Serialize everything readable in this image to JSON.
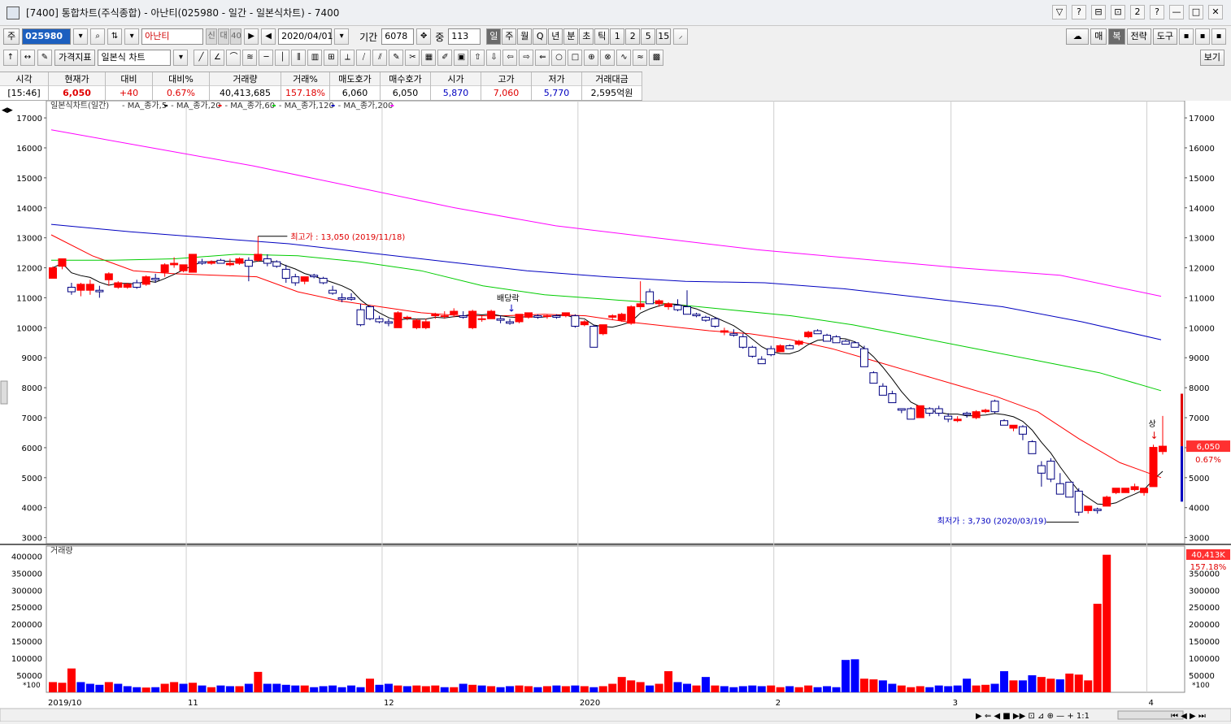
{
  "window": {
    "title": "[7400] 통합차트(주식종합) - 아난티(025980 - 일간 - 일본식차트) - 7400",
    "buttons": [
      "▽",
      "?",
      "⊟",
      "⊡",
      "2",
      "?",
      "—",
      "□",
      "✕"
    ]
  },
  "toolbar1": {
    "market": "주",
    "code": "025980",
    "name": "아난티",
    "name_tags": [
      "신",
      "대",
      "40"
    ],
    "date": "2020/04/01",
    "period_label": "기간",
    "period_value": "6078",
    "count_label": "중",
    "count_value": "113",
    "intervals": [
      "일",
      "주",
      "월",
      "Q",
      "년",
      "분",
      "초",
      "틱",
      "1",
      "2",
      "5",
      "15"
    ],
    "active_interval": "일",
    "right_buttons": [
      "매",
      "복",
      "전략",
      "도구"
    ]
  },
  "toolbar2": {
    "indicator_btn": "가격지표",
    "chart_type": "일본식 차트",
    "view_btn": "보기"
  },
  "quote": {
    "headers": [
      "시각",
      "현재가",
      "대비",
      "대비%",
      "거래량",
      "거래%",
      "매도호가",
      "매수호가",
      "시가",
      "고가",
      "저가",
      "거래대금"
    ],
    "values": [
      "[15:46]",
      "6,050",
      "+40",
      "0.67%",
      "40,413,685",
      "157.18%",
      "6,060",
      "6,050",
      "5,870",
      "7,060",
      "5,770",
      "2,595억원"
    ],
    "value_colors": [
      "#000000",
      "#e00000",
      "#e00000",
      "#e00000",
      "#000000",
      "#e00000",
      "#000000",
      "#000000",
      "#0000c0",
      "#e00000",
      "#0000c0",
      "#000000"
    ]
  },
  "chart": {
    "legend_title": "일본식차트(일간)",
    "legend_items": [
      {
        "name": "MA_종가,5",
        "color": "#000000"
      },
      {
        "name": "MA_종가,20",
        "color": "#ff0000"
      },
      {
        "name": "MA_종가,60",
        "color": "#00cc00"
      },
      {
        "name": "MA_종가,120",
        "color": "#0000c0"
      },
      {
        "name": "MA_종가,200",
        "color": "#ff00ff"
      }
    ],
    "annotations": {
      "high": "최고가 : 13,050 (2019/11/18)",
      "low": "최저가 : 3,730 (2020/03/19)",
      "dividend": "배당락",
      "upper_limit": "상"
    },
    "price_tag": "6,050",
    "price_pct": "0.67%",
    "volume_title": "거래량",
    "volume_tag": "40,413K",
    "volume_pct": "157.18%",
    "volume_unit": "*100",
    "x_labels": [
      "2019/10",
      "11",
      "12",
      "2020",
      "2",
      "3",
      "4"
    ],
    "price_axis": [
      17000,
      16000,
      15000,
      14000,
      13000,
      12000,
      11000,
      10000,
      9000,
      8000,
      7000,
      6000,
      5000,
      4000,
      3000
    ],
    "volume_axis": [
      400000,
      350000,
      300000,
      250000,
      200000,
      150000,
      100000,
      50000
    ]
  },
  "chart_data": {
    "type": "candlestick",
    "ylim": [
      2800,
      17300
    ],
    "candles": [
      [
        11650,
        12050,
        11650,
        12000
      ],
      [
        12050,
        12300,
        11950,
        12300
      ],
      [
        11350,
        11500,
        11100,
        11200
      ],
      [
        11250,
        11500,
        11050,
        11450
      ],
      [
        11250,
        11600,
        11100,
        11450
      ],
      [
        11250,
        11400,
        11000,
        11200
      ],
      [
        11600,
        11850,
        11400,
        11800
      ],
      [
        11350,
        11550,
        11300,
        11500
      ],
      [
        11350,
        11500,
        11300,
        11450
      ],
      [
        11500,
        11600,
        11300,
        11350
      ],
      [
        11450,
        11750,
        11400,
        11700
      ],
      [
        11650,
        11800,
        11500,
        11600
      ],
      [
        11850,
        12150,
        11700,
        12100
      ],
      [
        12100,
        12350,
        12000,
        12150
      ],
      [
        11900,
        12100,
        11850,
        12100
      ],
      [
        11850,
        12450,
        11850,
        12450
      ],
      [
        12200,
        12300,
        12100,
        12150
      ],
      [
        12150,
        12250,
        12100,
        12200
      ],
      [
        12250,
        12300,
        12150,
        12150
      ],
      [
        12100,
        12300,
        12050,
        12150
      ],
      [
        12150,
        12350,
        12100,
        12300
      ],
      [
        12250,
        12350,
        11550,
        12050
      ],
      [
        12250,
        13050,
        12200,
        12450
      ],
      [
        12300,
        12450,
        12050,
        12150
      ],
      [
        12200,
        12250,
        12000,
        12050
      ],
      [
        11950,
        12100,
        11500,
        11650
      ],
      [
        11700,
        11800,
        11400,
        11500
      ],
      [
        11550,
        11700,
        11450,
        11700
      ],
      [
        11750,
        11800,
        11650,
        11700
      ],
      [
        11650,
        11700,
        11450,
        11500
      ],
      [
        11250,
        11400,
        11100,
        11150
      ],
      [
        11000,
        11150,
        10850,
        10950
      ],
      [
        11000,
        11150,
        10900,
        10950
      ],
      [
        10600,
        10800,
        10050,
        10100
      ],
      [
        10700,
        10750,
        10250,
        10300
      ],
      [
        10300,
        10400,
        10150,
        10200
      ],
      [
        10200,
        10300,
        10050,
        10150
      ],
      [
        10000,
        10550,
        10000,
        10500
      ],
      [
        10350,
        10400,
        10250,
        10350
      ],
      [
        10000,
        10300,
        9950,
        10250
      ],
      [
        10000,
        10300,
        9950,
        10200
      ],
      [
        10400,
        10500,
        10300,
        10450
      ],
      [
        10400,
        10550,
        10300,
        10400
      ],
      [
        10450,
        10650,
        10350,
        10550
      ],
      [
        10400,
        10550,
        10300,
        10350
      ],
      [
        10000,
        10600,
        9950,
        10550
      ],
      [
        10300,
        10400,
        10200,
        10300
      ],
      [
        10300,
        10600,
        10300,
        10550
      ],
      [
        10300,
        10400,
        10150,
        10250
      ],
      [
        10200,
        10300,
        10100,
        10150
      ],
      [
        10200,
        10450,
        10150,
        10450
      ],
      [
        10350,
        10500,
        10300,
        10500
      ],
      [
        10400,
        10450,
        10300,
        10350
      ],
      [
        10400,
        10450,
        10300,
        10400
      ],
      [
        10400,
        10450,
        10300,
        10350
      ],
      [
        10400,
        10500,
        10350,
        10500
      ],
      [
        10400,
        10450,
        10000,
        10050
      ],
      [
        10100,
        10250,
        10050,
        10200
      ],
      [
        10050,
        10100,
        9350,
        9350
      ],
      [
        9800,
        10100,
        9750,
        10100
      ],
      [
        10350,
        10450,
        10250,
        10400
      ],
      [
        10250,
        10500,
        10200,
        10450
      ],
      [
        10150,
        10750,
        10100,
        10700
      ],
      [
        10700,
        11550,
        10600,
        10800
      ],
      [
        11200,
        11300,
        10800,
        10800
      ],
      [
        10800,
        10950,
        10700,
        10900
      ],
      [
        10700,
        10850,
        10600,
        10800
      ],
      [
        10750,
        10950,
        10550,
        10600
      ],
      [
        10700,
        11250,
        10500,
        10450
      ],
      [
        10450,
        10500,
        10350,
        10400
      ],
      [
        10350,
        10400,
        10200,
        10250
      ],
      [
        10300,
        10350,
        10000,
        10050
      ],
      [
        9850,
        10000,
        9750,
        9900
      ],
      [
        9800,
        9950,
        9700,
        9750
      ],
      [
        9700,
        9800,
        9300,
        9350
      ],
      [
        9350,
        9400,
        9000,
        9050
      ],
      [
        8950,
        9050,
        8800,
        8800
      ],
      [
        9300,
        9400,
        9050,
        9100
      ],
      [
        9200,
        9450,
        9200,
        9400
      ],
      [
        9400,
        9450,
        9300,
        9300
      ],
      [
        9450,
        9600,
        9400,
        9550
      ],
      [
        9700,
        9900,
        9650,
        9850
      ],
      [
        9900,
        9950,
        9800,
        9800
      ],
      [
        9750,
        9800,
        9550,
        9550
      ],
      [
        9700,
        9750,
        9500,
        9500
      ],
      [
        9550,
        9600,
        9450,
        9450
      ],
      [
        9500,
        9550,
        9350,
        9350
      ],
      [
        9300,
        9400,
        8700,
        8700
      ],
      [
        8500,
        8550,
        8150,
        8150
      ],
      [
        8050,
        8150,
        7750,
        7750
      ],
      [
        7800,
        7900,
        7500,
        7500
      ],
      [
        7300,
        7300,
        7150,
        7250
      ],
      [
        7300,
        7350,
        6950,
        6950
      ],
      [
        7000,
        7400,
        7000,
        7400
      ],
      [
        7300,
        7350,
        7050,
        7150
      ],
      [
        7300,
        7400,
        7050,
        7150
      ],
      [
        7050,
        7150,
        6850,
        6950
      ],
      [
        6900,
        7050,
        6850,
        6950
      ],
      [
        7150,
        7200,
        7000,
        7100
      ],
      [
        7000,
        7250,
        6950,
        7200
      ],
      [
        7200,
        7300,
        7150,
        7250
      ],
      [
        7550,
        7600,
        7150,
        7200
      ],
      [
        6900,
        6950,
        6750,
        6750
      ],
      [
        6650,
        6750,
        6550,
        6750
      ],
      [
        6700,
        6750,
        6250,
        6450
      ],
      [
        6200,
        6250,
        5800,
        5800
      ],
      [
        5400,
        5550,
        4700,
        5150
      ],
      [
        5550,
        5650,
        4850,
        4950
      ],
      [
        4800,
        5150,
        4450,
        4450
      ],
      [
        4850,
        4850,
        4350,
        4350
      ],
      [
        4550,
        4650,
        3730,
        3850
      ],
      [
        3900,
        4050,
        3800,
        4050
      ],
      [
        3950,
        4000,
        3800,
        3900
      ],
      [
        4050,
        4400,
        4050,
        4350
      ],
      [
        4500,
        4650,
        4450,
        4650
      ],
      [
        4500,
        4650,
        4500,
        4650
      ],
      [
        4600,
        4800,
        4550,
        4700
      ],
      [
        4500,
        4650,
        4400,
        4650
      ],
      [
        4700,
        6100,
        4700,
        6010
      ],
      [
        5870,
        7060,
        5770,
        6050
      ]
    ],
    "volume": [
      30,
      28,
      70,
      30,
      25,
      22,
      30,
      25,
      18,
      15,
      14,
      15,
      25,
      30,
      25,
      28,
      20,
      15,
      20,
      18,
      18,
      25,
      60,
      25,
      25,
      22,
      20,
      20,
      15,
      18,
      20,
      15,
      20,
      15,
      40,
      22,
      25,
      20,
      18,
      20,
      18,
      20,
      15,
      15,
      25,
      22,
      20,
      18,
      15,
      18,
      20,
      18,
      15,
      18,
      20,
      18,
      20,
      18,
      15,
      18,
      25,
      45,
      35,
      30,
      20,
      25,
      62,
      30,
      25,
      20,
      45,
      20,
      18,
      15,
      18,
      20,
      18,
      20,
      15,
      18,
      15,
      20,
      15,
      18,
      15,
      95,
      97,
      40,
      38,
      35,
      25,
      20,
      15,
      18,
      15,
      20,
      18,
      20,
      40,
      20,
      22,
      25,
      62,
      35,
      35,
      50,
      45,
      40,
      38,
      55,
      52,
      35,
      260,
      404
    ],
    "volume_up": [
      1,
      1,
      1,
      0,
      0,
      0,
      1,
      0,
      0,
      0,
      1,
      0,
      1,
      1,
      0,
      1,
      0,
      1,
      0,
      0,
      1,
      0,
      1,
      0,
      0,
      0,
      0,
      1,
      0,
      0,
      0,
      0,
      0,
      0,
      1,
      0,
      0,
      1,
      0,
      1,
      1,
      1,
      0,
      1,
      0,
      1,
      0,
      1,
      0,
      0,
      1,
      1,
      0,
      1,
      0,
      1,
      0,
      1,
      0,
      1,
      1,
      1,
      1,
      1,
      0,
      1,
      1,
      0,
      0,
      1,
      0,
      1,
      0,
      0,
      0,
      0,
      0,
      1,
      1,
      0,
      1,
      1,
      0,
      0,
      0,
      0,
      0,
      1,
      1,
      0,
      0,
      1,
      1,
      1,
      0,
      0,
      0,
      0,
      0,
      1,
      1,
      0,
      0,
      1,
      0,
      0,
      1,
      1,
      0,
      1,
      1,
      1,
      1,
      1
    ],
    "ma_series": [
      {
        "name": "MA_종가,20",
        "color": "#ff0000",
        "values": [
          13100,
          12400,
          11900,
          11800,
          11750,
          11700,
          11200,
          10900,
          10700,
          10500,
          10400,
          10400,
          10450,
          10400,
          10200,
          10050,
          9900,
          9800,
          9600,
          9300,
          8900,
          8500,
          8100,
          7700,
          7200,
          6300,
          5500,
          5000
        ]
      },
      {
        "name": "MA_종가,60",
        "color": "#00cc00",
        "values": [
          12250,
          12250,
          12300,
          12450,
          12400,
          12200,
          11900,
          11400,
          11100,
          10950,
          10800,
          10600,
          10400,
          10100,
          9700,
          9300,
          8900,
          8500,
          7900
        ]
      },
      {
        "name": "MA_종가,120",
        "color": "#0000c0",
        "values": [
          13450,
          13200,
          13000,
          12800,
          12500,
          12200,
          11900,
          11700,
          11550,
          11500,
          11300,
          11000,
          10700,
          10200,
          9600
        ]
      },
      {
        "name": "MA_종가,200",
        "color": "#ff00ff",
        "values": [
          16600,
          16000,
          15400,
          14700,
          14000,
          13400,
          13000,
          12600,
          12300,
          12000,
          11750,
          11050
        ]
      }
    ]
  }
}
